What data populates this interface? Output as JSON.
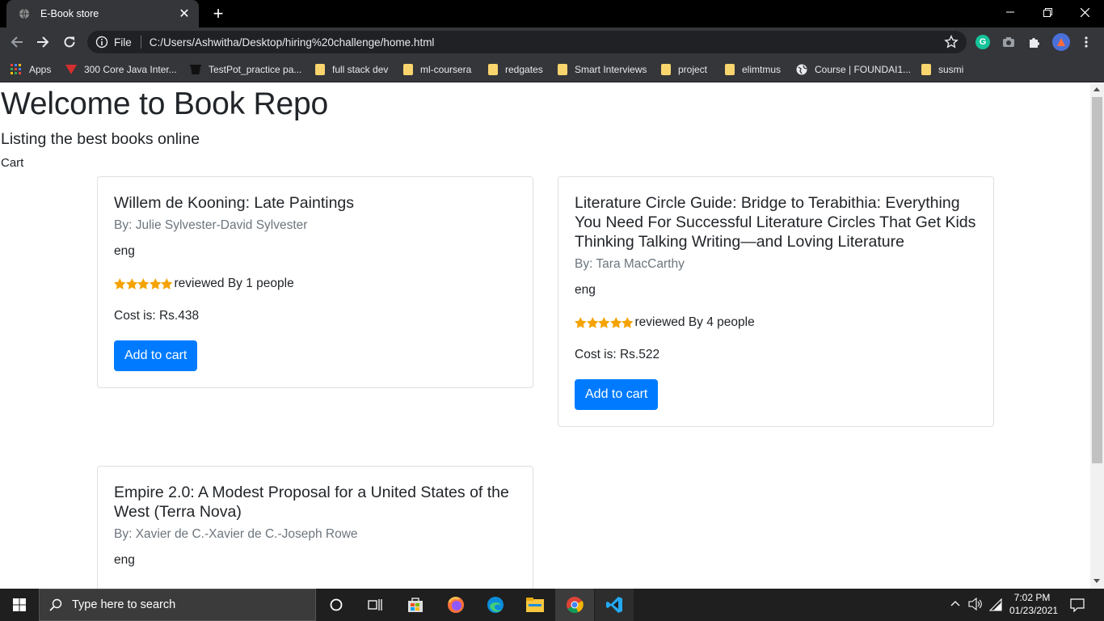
{
  "browser": {
    "tab": {
      "title": "E-Book store"
    },
    "address": {
      "scheme": "File",
      "url": "C:/Users/Ashwitha/Desktop/hiring%20challenge/home.html"
    },
    "bookmarks": [
      {
        "label": "Apps",
        "icon": "apps-grid-icon"
      },
      {
        "label": "300 Core Java Inter...",
        "icon": "red-triangle-icon"
      },
      {
        "label": "TestPot_practice pa...",
        "icon": "bucket-icon"
      },
      {
        "label": "full stack dev",
        "icon": "folder-icon"
      },
      {
        "label": "ml-coursera",
        "icon": "folder-icon"
      },
      {
        "label": "redgates",
        "icon": "folder-icon"
      },
      {
        "label": "Smart Interviews",
        "icon": "folder-icon"
      },
      {
        "label": "project",
        "icon": "folder-icon"
      },
      {
        "label": "elimtmus",
        "icon": "folder-icon"
      },
      {
        "label": "Course | FOUNDAI1...",
        "icon": "globe-icon"
      },
      {
        "label": "susmi",
        "icon": "folder-icon"
      }
    ]
  },
  "page": {
    "title": "Welcome to Book Repo",
    "subtitle": "Listing the best books online",
    "cart_label": "Cart",
    "books": [
      {
        "title": "Willem de Kooning: Late Paintings",
        "author": "By: Julie Sylvester-David Sylvester",
        "language": "eng",
        "rating": 5,
        "reviews": "reviewed By 1 people",
        "cost": "Cost is: Rs.438",
        "button": "Add to cart"
      },
      {
        "title": "Literature Circle Guide: Bridge to Terabithia: Everything You Need For Successful Literature Circles That Get Kids Thinking Talking Writing—and Loving Literature",
        "author": "By: Tara MacCarthy",
        "language": "eng",
        "rating": 5,
        "reviews": "reviewed By 4 people",
        "cost": "Cost is: Rs.522",
        "button": "Add to cart"
      },
      {
        "title": "Empire 2.0: A Modest Proposal for a United States of the West (Terra Nova)",
        "author": "By: Xavier de C.-Xavier de C.-Joseph Rowe",
        "language": "eng"
      }
    ]
  },
  "taskbar": {
    "search_placeholder": "Type here to search",
    "time": "7:02 PM",
    "date": "01/23/2021"
  },
  "colors": {
    "primary_button": "#007bff",
    "star": "#f4a300",
    "chrome_dark": "#35363a"
  }
}
